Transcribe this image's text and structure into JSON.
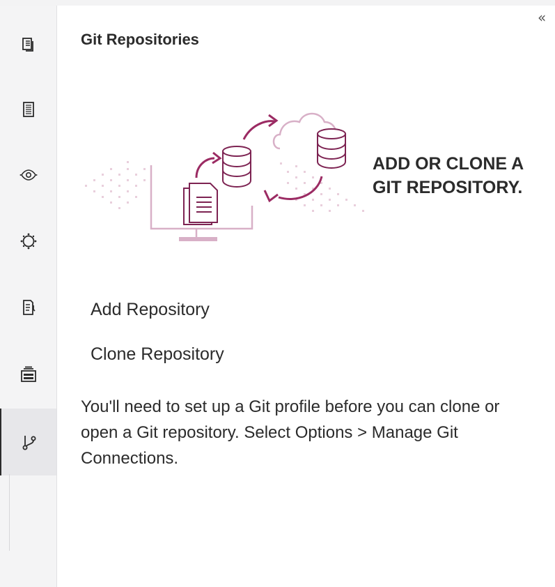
{
  "panel": {
    "title": "Git Repositories",
    "collapse_glyph": "«"
  },
  "hero": {
    "line1": "ADD OR CLONE A",
    "line2": "GIT REPOSITORY."
  },
  "actions": {
    "add_label": "Add Repository",
    "clone_label": "Clone Repository"
  },
  "help": {
    "text": "You'll need to set up a Git profile before you can clone or open a Git repository. Select Options > Manage Git Connections."
  },
  "rail": {
    "items": [
      {
        "icon": "open-items-icon"
      },
      {
        "icon": "document-list-icon"
      },
      {
        "icon": "eye-icon"
      },
      {
        "icon": "settings-icon"
      },
      {
        "icon": "document-edit-icon"
      },
      {
        "icon": "libraries-icon"
      },
      {
        "icon": "git-branch-icon",
        "active": true
      }
    ]
  },
  "colors": {
    "accent": "#9b2b63",
    "accent_light": "#d8b0c7",
    "rail_bg": "#f4f4f5",
    "text": "#2b2b2b"
  }
}
